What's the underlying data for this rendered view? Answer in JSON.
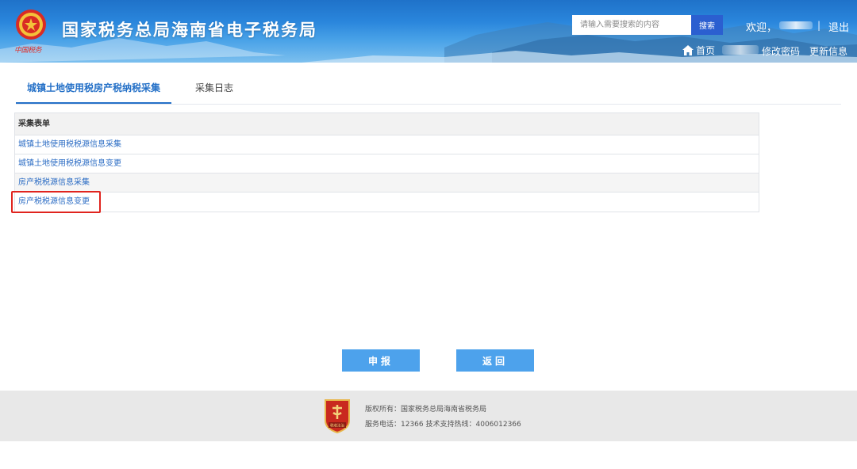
{
  "header": {
    "title": "国家税务总局海南省电子税务局",
    "emblem_caption": "中国税务",
    "search": {
      "placeholder": "请输入需要搜索的内容",
      "button": "搜索"
    },
    "welcome": "欢迎，",
    "separator": "|",
    "logout": "退出",
    "home": "首页",
    "change_password": "修改密码",
    "update_info": "更新信息"
  },
  "tabs": [
    {
      "label": "城镇土地使用税房产税纳税采集",
      "active": true
    },
    {
      "label": "采集日志",
      "active": false
    }
  ],
  "form_table": {
    "header": "采集表单",
    "rows": [
      {
        "label": "城镇土地使用税税源信息采集"
      },
      {
        "label": "城镇土地使用税税源信息变更"
      },
      {
        "label": "房产税税源信息采集"
      },
      {
        "label": "房产税税源信息变更",
        "highlighted": true
      }
    ]
  },
  "buttons": {
    "submit": "申报",
    "back": "返回"
  },
  "footer": {
    "logo_caption": "税收法治",
    "copyright": "版权所有：国家税务总局海南省税务局",
    "service": "服务电话：12366 技术支持热线：4006012366"
  },
  "colors": {
    "header_blue": "#2a86dc",
    "link_blue": "#2b6cc4",
    "button_blue": "#4da2ec",
    "highlight_red": "#e0241e",
    "footer_bg": "#e8e8e8"
  },
  "icons": [
    "emblem-icon",
    "home-icon",
    "footer-logo-icon"
  ]
}
